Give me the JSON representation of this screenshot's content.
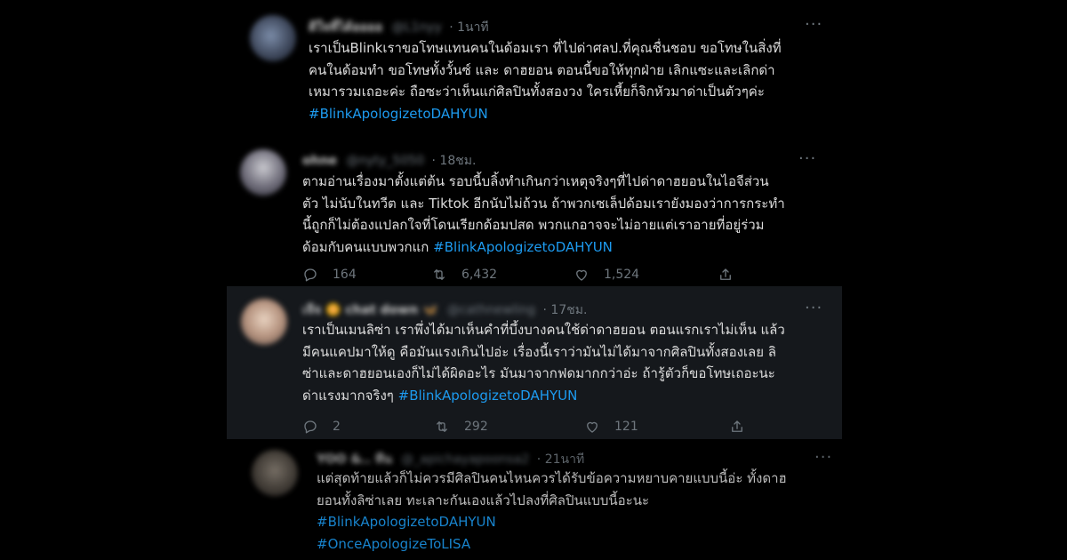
{
  "tweets": [
    {
      "name": "ดีใจที่ได้ออออ",
      "handle": "@L1nyy",
      "time": "· 1นาที",
      "lines": [
        "เราเป็นBlinkเราขอโทษแทนคนในด้อมเรา ที่ไปด่าศลป.ที่คุณชื่นชอบ ขอโทษในสิ่งที่",
        "คนในด้อมทำ ขอโทษทั้งวั้นซ์ และ ดาฮยอน ตอนนี้ขอให้ทุกฝ่าย เลิกแซะและเลิกด่า",
        "เหมารวมเถอะค่ะ ถือซะว่าเห็นแก่ศิลปินทั้งสองวง ใครเหี้ยก็จิกหัวมาด่าเป็นตัวๆค่ะ"
      ],
      "hashtags": [
        "#BlinkApologizetoDAHYUN"
      ]
    },
    {
      "name": "ohne",
      "handle": "@nyty_5050",
      "time": "· 18ชม.",
      "lines": [
        "ตามอ่านเรื่องมาตั้งแต่ต้น รอบนี้บลิ้งทำเกินกว่าเหตุจริงๆที่ไปด่าดาฮยอนในไอจีส่วน",
        "ตัว ไม่นับในทวีต และ Tiktok อีกนับไม่ถ้วน ถ้าพวกเซเล็ปด้อมเรายังมองว่าการกระทำ",
        "นี้ถูกก็ไม่ต้องแปลกใจที่โดนเรียกด้อมปสด พวกแกอาจจะไม่อายแต่เราอายที่อยู่ร่วม",
        "ด้อมกับคนแบบพวกแก"
      ],
      "hashtags": [
        "#BlinkApologizetoDAHYUN"
      ],
      "stats": {
        "replies": "164",
        "retweets": "6,432",
        "likes": "1,524"
      }
    },
    {
      "name": "เจีจ 🌼 chat down 🦋",
      "handle": "@cathnewling",
      "time": "· 17ชม.",
      "lines": [
        "เราเป็นเมนลิซ่า เราพึ่งได้มาเห็นคำที่บึ้งบางคนใช้ด่าดาฮยอน ตอนแรกเราไม่เห็น แล้ว",
        "มีคนแคปมาให้ดู คือมันแรงเกินไปอ่ะ เรื่องนี้เราว่ามันไม่ได้มาจากศิลปินทั้งสองเลย ลิ",
        "ซ่าและดาฮยอนเองก็ไม่ได้ผิดอะไร มันมาจากฟดมากกว่าอ่ะ ถ้ารู้ตัวก็ขอโทษเถอะนะ",
        "ด่าแรงมากจริงๆ"
      ],
      "hashtags": [
        "#BlinkApologizetoDAHYUN"
      ],
      "stats": {
        "replies": "2",
        "retweets": "292",
        "likes": "121"
      }
    },
    {
      "name": "YOO &.. ทีน",
      "handle": "@_apichayapoonsa2",
      "time": "· 21นาที",
      "lines": [
        "แต่สุดท้ายแล้วก็ไม่ควรมีศิลปินคนไหนควรได้รับข้อความหยาบคายแบบนี้อ่ะ ทั้งดาฮ",
        "ยอนทั้งลิซ่าเลย ทะเลาะกันเองแล้วไปลงที่ศิลปินแบบนี้อะนะ"
      ],
      "hashtags": [
        "#BlinkApologizetoDAHYUN",
        "#OnceApologizeToLISA"
      ]
    }
  ],
  "more_label": "···",
  "icons": {
    "reply": "reply-icon",
    "retweet": "retweet-icon",
    "like": "heart-icon",
    "share": "share-icon"
  },
  "colors": {
    "background": "#000000",
    "highlighted_tweet": "#15181c",
    "hashtag": "#1d9bf0",
    "secondary_text": "#6e767d"
  }
}
